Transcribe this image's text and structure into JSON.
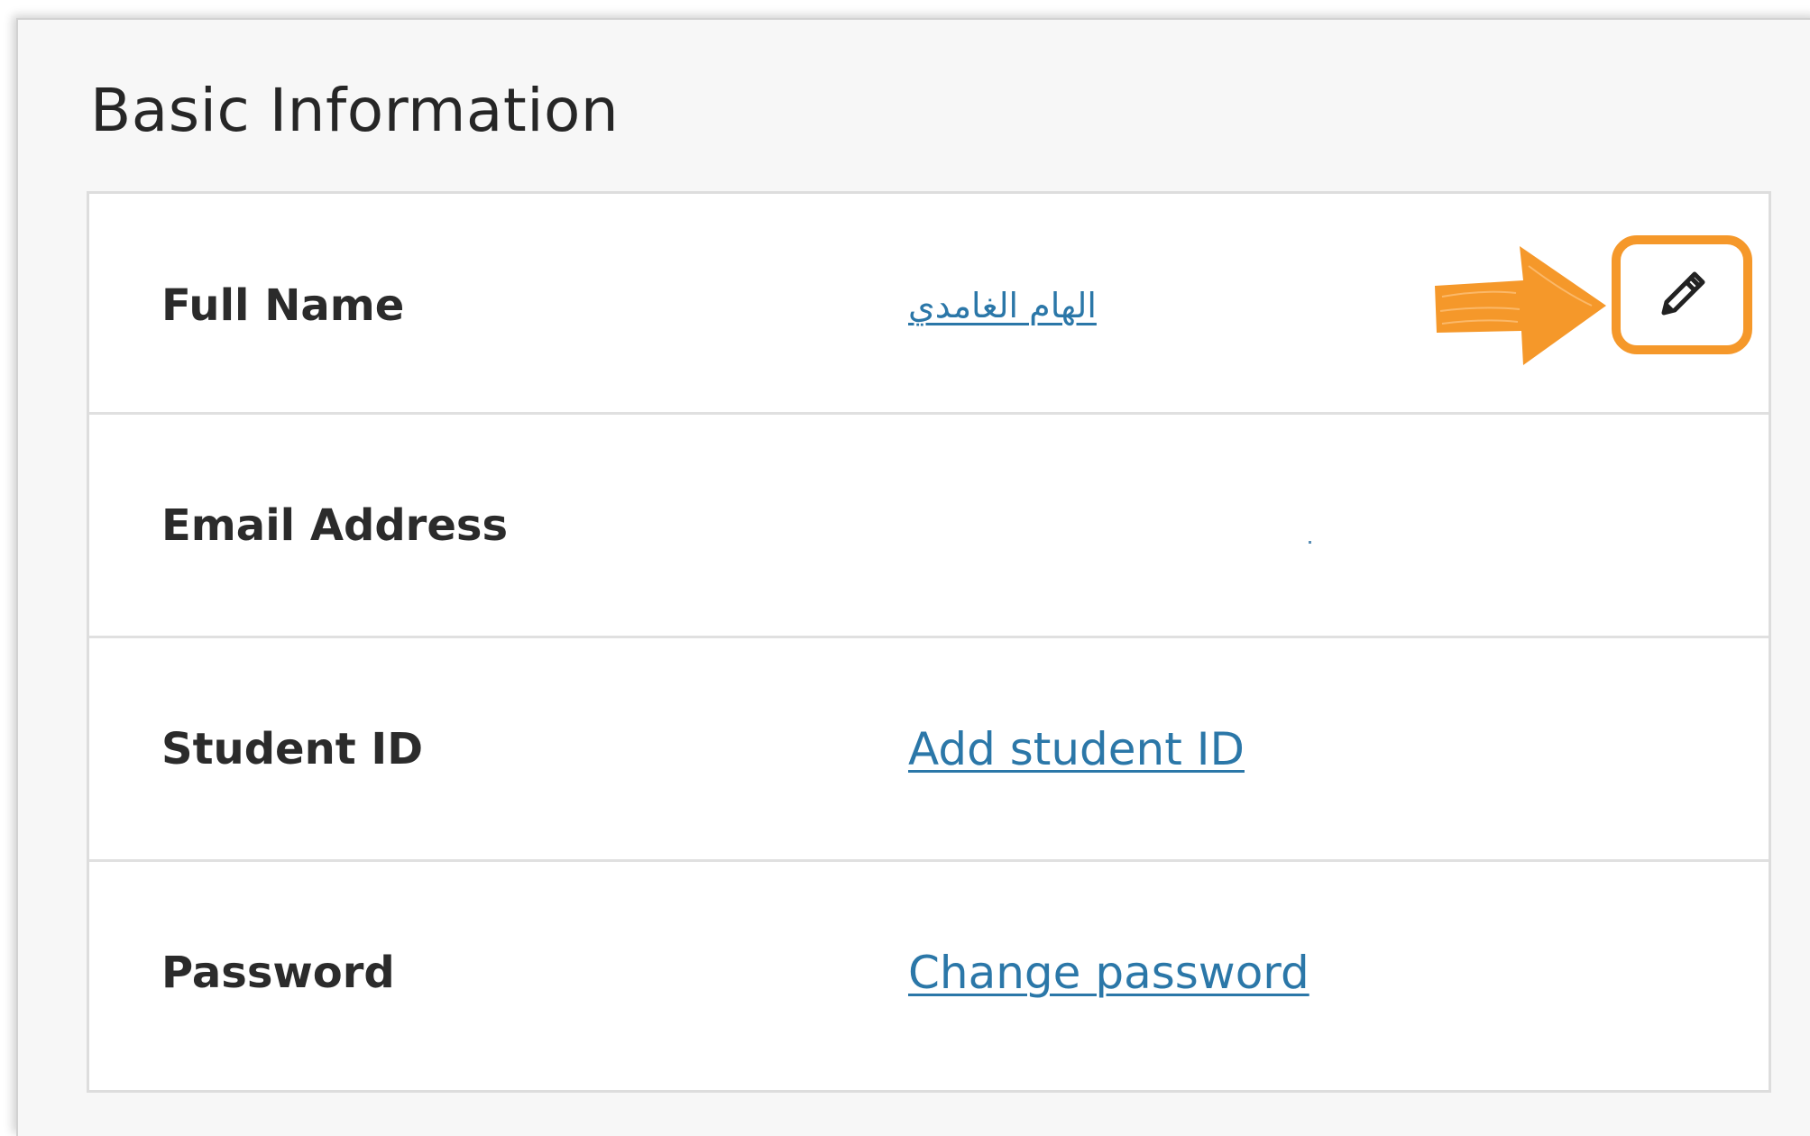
{
  "section": {
    "title": "Basic Information"
  },
  "rows": [
    {
      "label": "Full Name",
      "value": "الهام الغامدي"
    },
    {
      "label": "Email Address",
      "value": ""
    },
    {
      "label": "Student ID",
      "value": "Add student ID"
    },
    {
      "label": "Password",
      "value": "Change password"
    }
  ],
  "icons": {
    "edit": "pencil-icon",
    "annotation": "arrow-right-icon"
  },
  "colors": {
    "link": "#2b77a8",
    "annotation": "#f5982a",
    "label": "#2b2b2b",
    "background": "#f7f7f7"
  }
}
